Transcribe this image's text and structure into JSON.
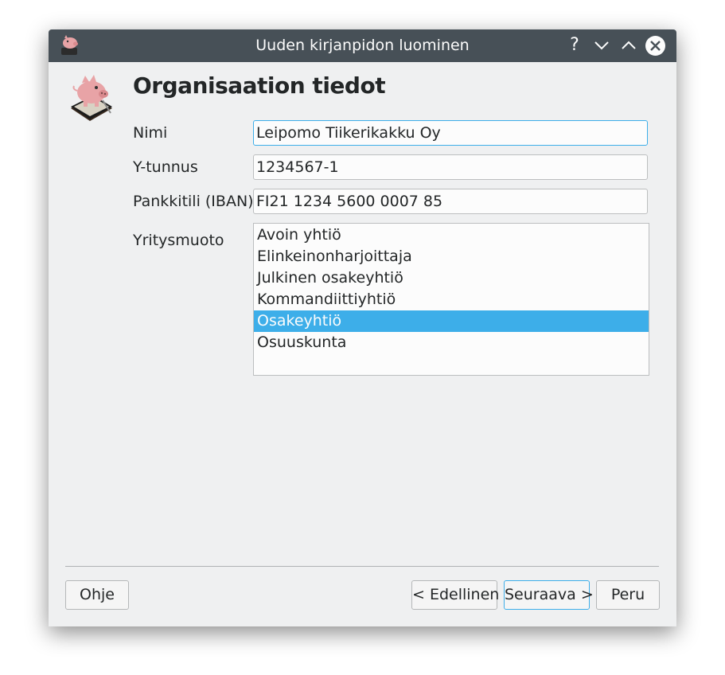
{
  "window": {
    "title": "Uuden kirjanpidon luominen",
    "controls": {
      "help_label": "?"
    }
  },
  "page": {
    "title": "Organisaation tiedot"
  },
  "form": {
    "name": {
      "label": "Nimi",
      "value": "Leipomo Tiikerikakku Oy"
    },
    "business_id": {
      "label": "Y-tunnus",
      "value": "1234567-1"
    },
    "bank_account": {
      "label": "Pankkitili (IBAN)",
      "value": "FI21 1234 5600 0007 85"
    },
    "company_form": {
      "label": "Yritysmuoto",
      "options": [
        "Avoin yhtiö",
        "Elinkeinonharjoittaja",
        "Julkinen osakeyhtiö",
        "Kommandiittiyhtiö",
        "Osakeyhtiö",
        "Osuuskunta"
      ],
      "selected": "Osakeyhtiö"
    }
  },
  "buttons": {
    "help": "Ohje",
    "previous": "< Edellinen",
    "next": "Seuraava >",
    "cancel": "Peru"
  },
  "colors": {
    "titlebar": "#475057",
    "accent": "#3daee9",
    "window_bg": "#eff0f1"
  },
  "icons": {
    "app_icon": "piggy-bank-book-icon",
    "help": "question-mark-icon",
    "minimize": "chevron-down-icon",
    "maximize": "chevron-up-icon",
    "close": "close-icon"
  }
}
